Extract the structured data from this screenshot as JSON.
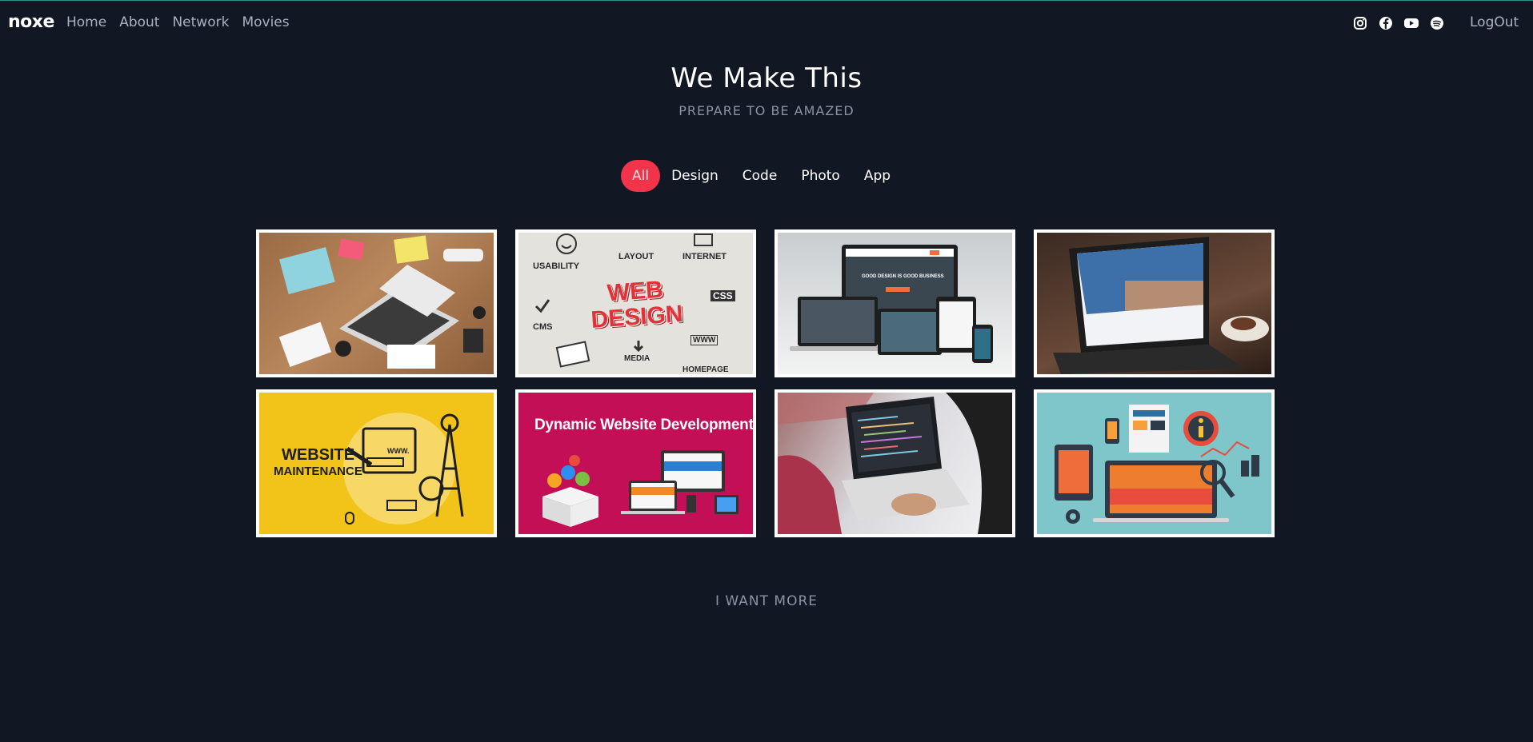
{
  "nav": {
    "brand": "noxe",
    "links": [
      "Home",
      "About",
      "Network",
      "Movies"
    ],
    "social_icons": [
      "instagram-icon",
      "facebook-icon",
      "youtube-icon",
      "spotify-icon"
    ],
    "logout": "LogOut"
  },
  "hero": {
    "title": "We Make This",
    "subtitle": "PREPARE TO BE AMAZED"
  },
  "filters": {
    "items": [
      "All",
      "Design",
      "Code",
      "Photo",
      "App"
    ],
    "active": "All"
  },
  "gallery": {
    "tiles": [
      {
        "kind": "desk-photo"
      },
      {
        "kind": "web-design-sketch",
        "caption": "WEB DESIGN",
        "words": [
          "USABILITY",
          "LAYOUT",
          "INTERNET",
          "CSS",
          "CMS",
          "WWW",
          "MEDIA",
          "HOMEPAGE"
        ]
      },
      {
        "kind": "responsive-devices",
        "caption": "GOOD DESIGN IS GOOD BUSINESS"
      },
      {
        "kind": "laptop-photo"
      },
      {
        "kind": "website-maintenance",
        "caption_line1": "WEBSITE",
        "caption_line2": "MAINTENANCE",
        "extra": "WWW."
      },
      {
        "kind": "dynamic-web",
        "caption": "Dynamic Website Development"
      },
      {
        "kind": "coding-photo"
      },
      {
        "kind": "infographic"
      }
    ]
  },
  "more": "I WANT MORE",
  "colors": {
    "background": "#111723",
    "accent": "#f2344b",
    "muted": "#8a93a3"
  }
}
